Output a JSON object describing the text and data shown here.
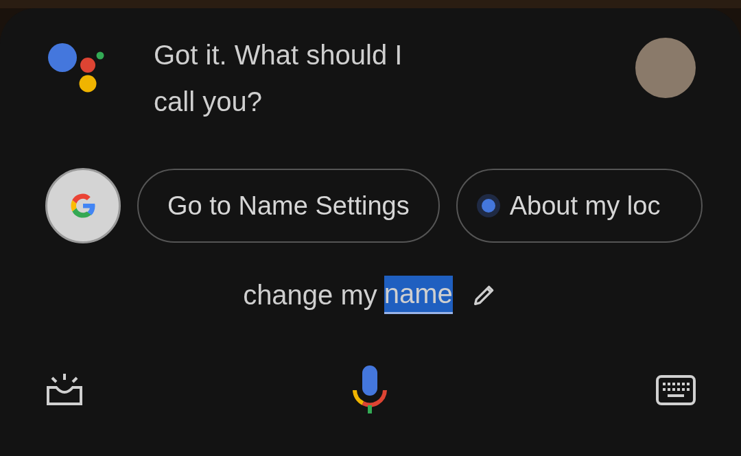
{
  "message": {
    "text": "Got it. What should I call you?"
  },
  "chips": [
    {
      "kind": "plain",
      "label": "Go to Name Settings"
    },
    {
      "kind": "dot",
      "label": "About my loc"
    }
  ],
  "query": [
    {
      "text": "change my",
      "selected": false
    },
    {
      "text": "name",
      "selected": true
    }
  ]
}
